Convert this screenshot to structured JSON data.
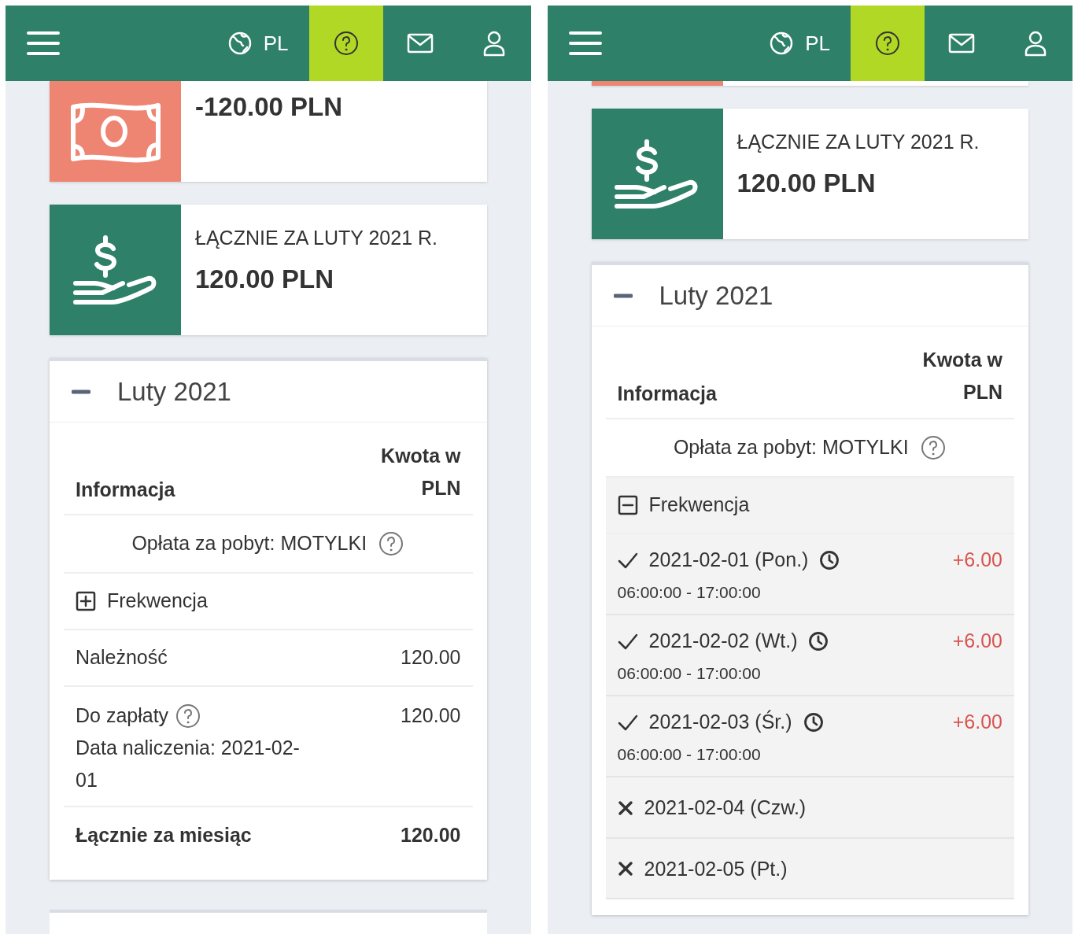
{
  "panels": [
    {
      "topbar": {
        "language": "PL",
        "items": [
          {
            "kind": "help",
            "selected": true
          },
          {
            "kind": "mail",
            "selected": false
          },
          {
            "kind": "user",
            "selected": false
          }
        ]
      },
      "cards": [
        {
          "kind": "expense",
          "amount": "-120.00 PLN"
        },
        {
          "kind": "income",
          "title": "ŁĄCZNIE ZA LUTY 2021 R.",
          "amount": "120.00 PLN"
        }
      ],
      "month": {
        "title": "Luty 2021",
        "expanded": true,
        "columns": [
          "Informacja",
          "Kwota w PLN"
        ],
        "fee_label": "Opłata za pobyt: MOTYLKI",
        "attendance": {
          "label": "Frekwencja",
          "expanded": false
        },
        "rows": [
          {
            "kind": "plain",
            "label": "Należność",
            "value": "120.00"
          },
          {
            "kind": "due",
            "label": "Do zapłaty",
            "note": "Data naliczenia: 2021-02-01",
            "value": "120.00"
          },
          {
            "kind": "total",
            "label": "Łącznie za miesiąc",
            "value": "120.00"
          }
        ]
      },
      "next_card": true
    },
    {
      "topbar": {
        "language": "PL",
        "items": [
          {
            "kind": "help",
            "selected": true
          },
          {
            "kind": "mail",
            "selected": false
          },
          {
            "kind": "user",
            "selected": false
          }
        ]
      },
      "cards": [
        {
          "kind": "expense_edge"
        },
        {
          "kind": "income",
          "title": "ŁĄCZNIE ZA LUTY 2021 R.",
          "amount": "120.00 PLN"
        }
      ],
      "month": {
        "title": "Luty 2021",
        "expanded": true,
        "columns": [
          "Informacja",
          "Kwota w PLN"
        ],
        "fee_label": "Opłata za pobyt: MOTYLKI",
        "attendance": {
          "label": "Frekwencja",
          "expanded": true,
          "days": [
            {
              "present": true,
              "date": "2021-02-01 (Pon.)",
              "amount": "+6.00",
              "time": "06:00:00 - 17:00:00"
            },
            {
              "present": true,
              "date": "2021-02-02 (Wt.)",
              "amount": "+6.00",
              "time": "06:00:00 - 17:00:00"
            },
            {
              "present": true,
              "date": "2021-02-03 (Śr.)",
              "amount": "+6.00",
              "time": "06:00:00 - 17:00:00"
            },
            {
              "present": false,
              "date": "2021-02-04 (Czw.)"
            },
            {
              "present": false,
              "date": "2021-02-05 (Pt.)"
            }
          ]
        }
      }
    }
  ]
}
